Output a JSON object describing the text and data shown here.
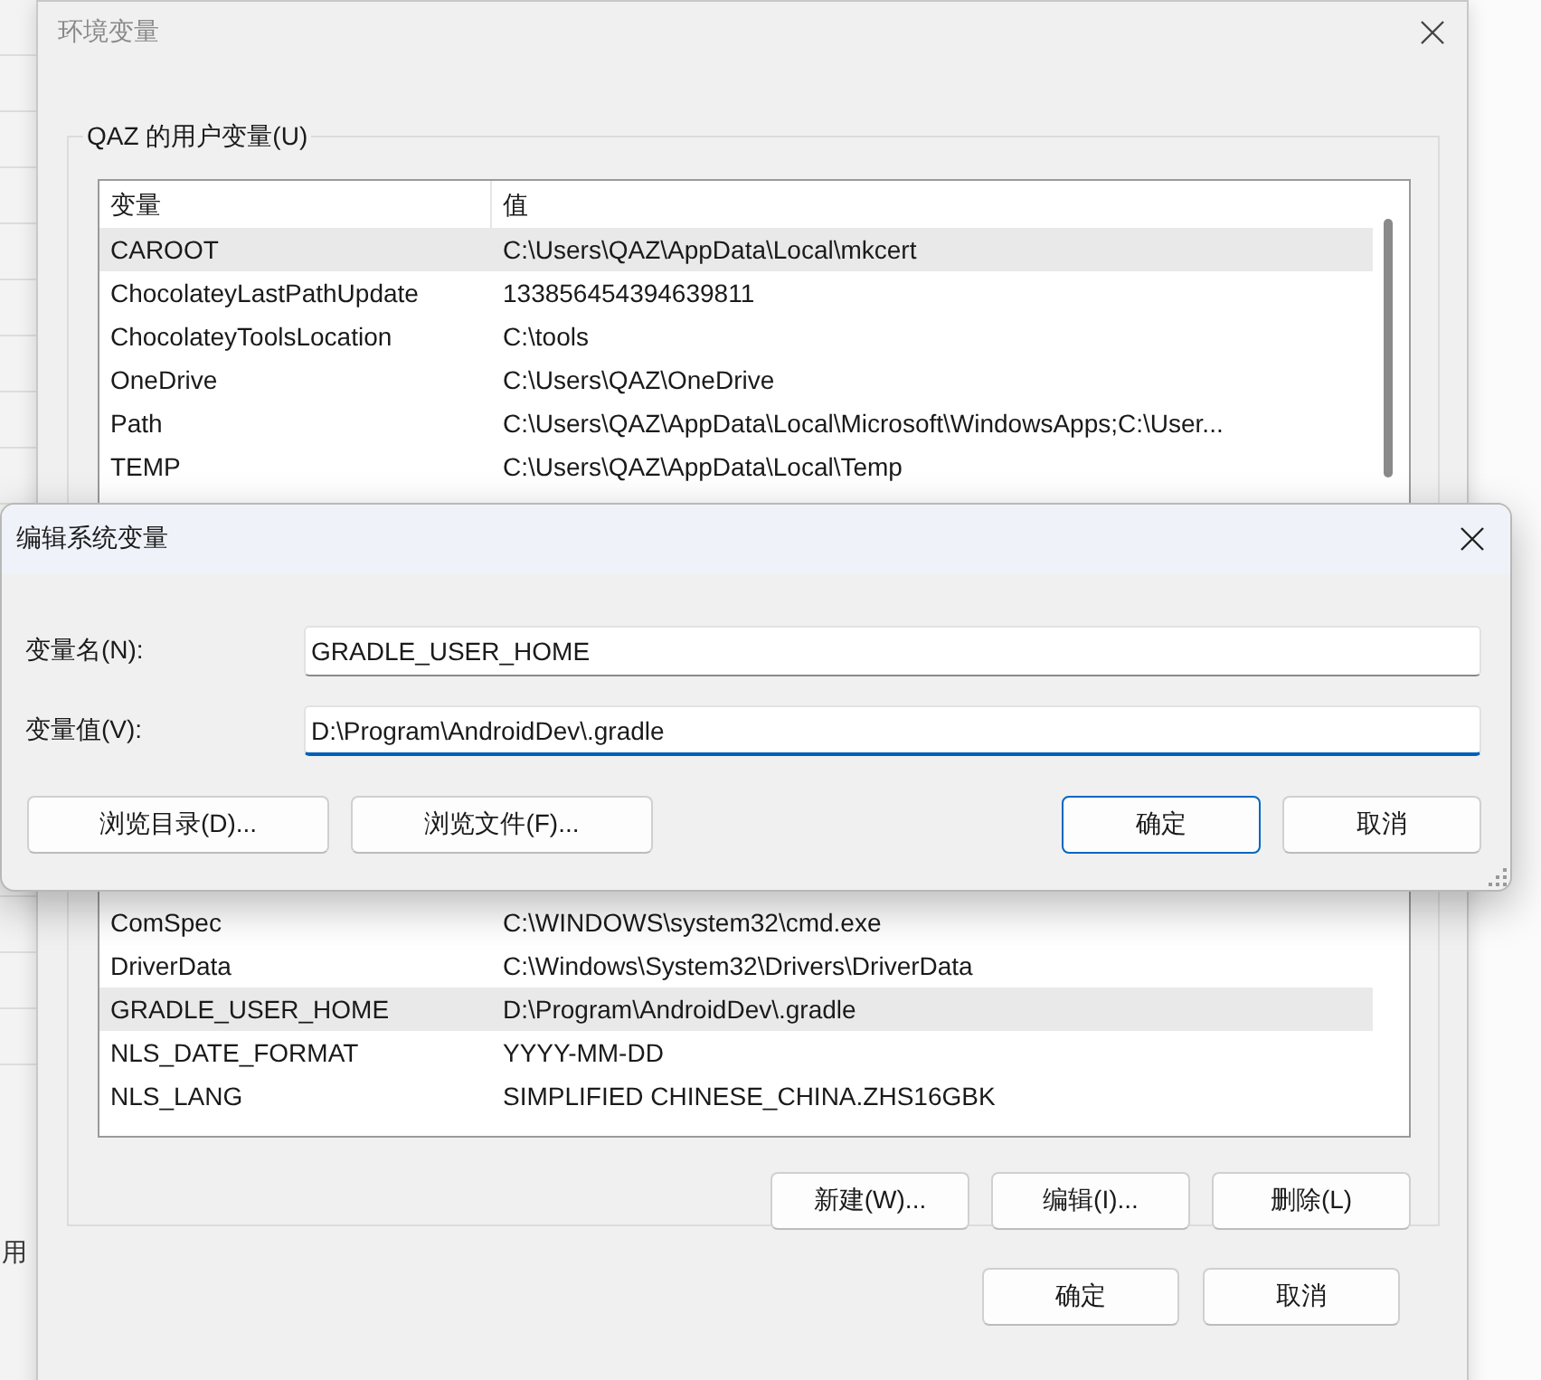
{
  "background_window": {
    "text": "用"
  },
  "window": {
    "title": "环境变量"
  },
  "user_variables": {
    "label": "QAZ 的用户变量(U)",
    "columns": [
      "变量",
      "值"
    ],
    "rows": [
      {
        "name": "CAROOT",
        "value": "C:\\Users\\QAZ\\AppData\\Local\\mkcert",
        "selected": true
      },
      {
        "name": "ChocolateyLastPathUpdate",
        "value": "133856454394639811",
        "selected": false
      },
      {
        "name": "ChocolateyToolsLocation",
        "value": "C:\\tools",
        "selected": false
      },
      {
        "name": "OneDrive",
        "value": "C:\\Users\\QAZ\\OneDrive",
        "selected": false
      },
      {
        "name": "Path",
        "value": "C:\\Users\\QAZ\\AppData\\Local\\Microsoft\\WindowsApps;C:\\User...",
        "selected": false
      },
      {
        "name": "TEMP",
        "value": "C:\\Users\\QAZ\\AppData\\Local\\Temp",
        "selected": false
      }
    ]
  },
  "system_variables": {
    "rows": [
      {
        "name": "ComSpec",
        "value": "C:\\WINDOWS\\system32\\cmd.exe",
        "selected": false
      },
      {
        "name": "DriverData",
        "value": "C:\\Windows\\System32\\Drivers\\DriverData",
        "selected": false
      },
      {
        "name": "GRADLE_USER_HOME",
        "value": "D:\\Program\\AndroidDev\\.gradle",
        "selected": true
      },
      {
        "name": "NLS_DATE_FORMAT",
        "value": "YYYY-MM-DD",
        "selected": false
      },
      {
        "name": "NLS_LANG",
        "value": "SIMPLIFIED CHINESE_CHINA.ZHS16GBK",
        "selected": false
      }
    ],
    "buttons": [
      "新建(W)...",
      "编辑(I)...",
      "删除(L)"
    ]
  },
  "buttons": [
    "确定",
    "取消"
  ],
  "edit_dialog": {
    "title": "编辑系统变量",
    "fields": [
      {
        "label": "变量名(N):",
        "value": "GRADLE_USER_HOME",
        "focused": false
      },
      {
        "label": "变量值(V):",
        "value": "D:\\Program\\AndroidDev\\.gradle",
        "focused": true
      }
    ],
    "browse_buttons": [
      "浏览目录(D)...",
      "浏览文件(F)..."
    ],
    "buttons": [
      {
        "label": "确定",
        "default": true
      },
      {
        "label": "取消",
        "default": false
      }
    ]
  }
}
